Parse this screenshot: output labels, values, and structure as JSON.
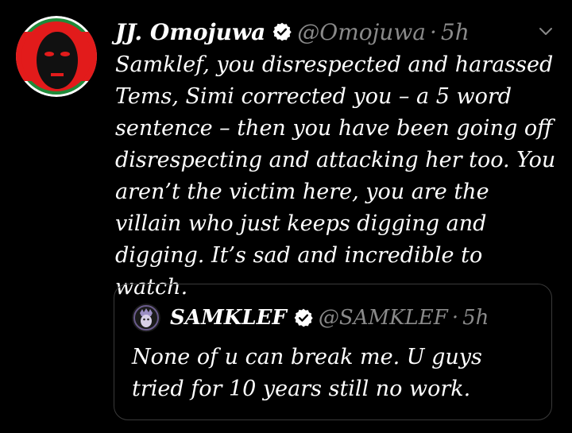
{
  "tweet": {
    "author_name": "JJ. Omojuwa",
    "author_handle": "@Omojuwa",
    "separator": "·",
    "time": "5h",
    "text": "Samklef, you disrespected and harassed Tems, Simi corrected you – a 5 word sentence – then you have been going off disrespecting and attacking her too. You aren’t the victim here, you are the villain who just keeps digging and digging. It’s sad and incredible to watch."
  },
  "quote": {
    "author_name": "SAMKLEF",
    "author_handle": "@SAMKLEF",
    "separator": "·",
    "time": "5h",
    "text": "None of u can break me. U guys tried for 10 years still no work."
  },
  "icons": {
    "verified": "verified-badge-icon",
    "more": "chevron-down-icon"
  },
  "colors": {
    "background": "#000000",
    "text": "#ffffff",
    "muted": "#8a8a8a",
    "avatar_red": "#e21b1b",
    "avatar_green": "#1f8a3a"
  }
}
